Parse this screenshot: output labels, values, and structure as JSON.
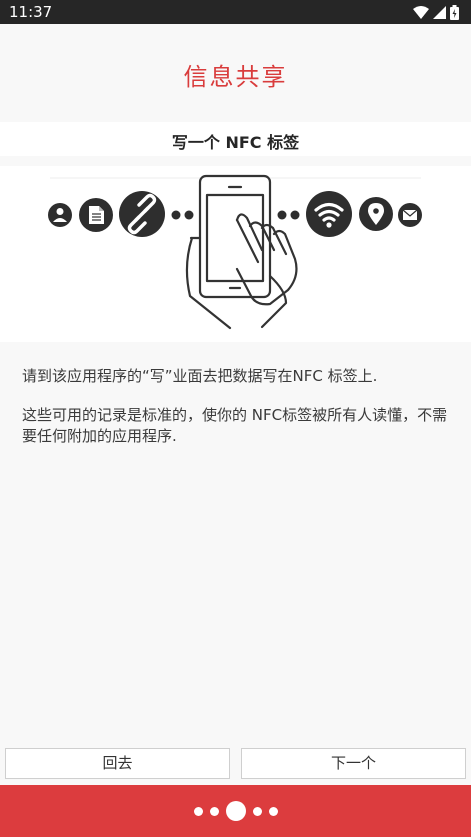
{
  "status_bar": {
    "time": "11:37"
  },
  "header": {
    "title": "信息共享"
  },
  "section": {
    "subtitle": "写一个 NFC 标签"
  },
  "description": {
    "paragraph1": "请到该应用程序的“写”业面去把数据写在NFC 标签上.",
    "paragraph2": "这些可用的记录是标准的，使你的 NFC标签被所有人读懂，不需要任何附加的应用程序."
  },
  "buttons": {
    "back_label": "回去",
    "next_label": "下一个"
  },
  "pager": {
    "total": 5,
    "current": 3
  },
  "colors": {
    "accent": "#dc3c3e",
    "title": "#d93c3c",
    "icon": "#2e2e2e"
  },
  "illustration_icons": [
    "contact-icon",
    "document-icon",
    "link-icon",
    "phone-hand-icon",
    "wifi-icon",
    "location-icon",
    "mail-icon"
  ]
}
